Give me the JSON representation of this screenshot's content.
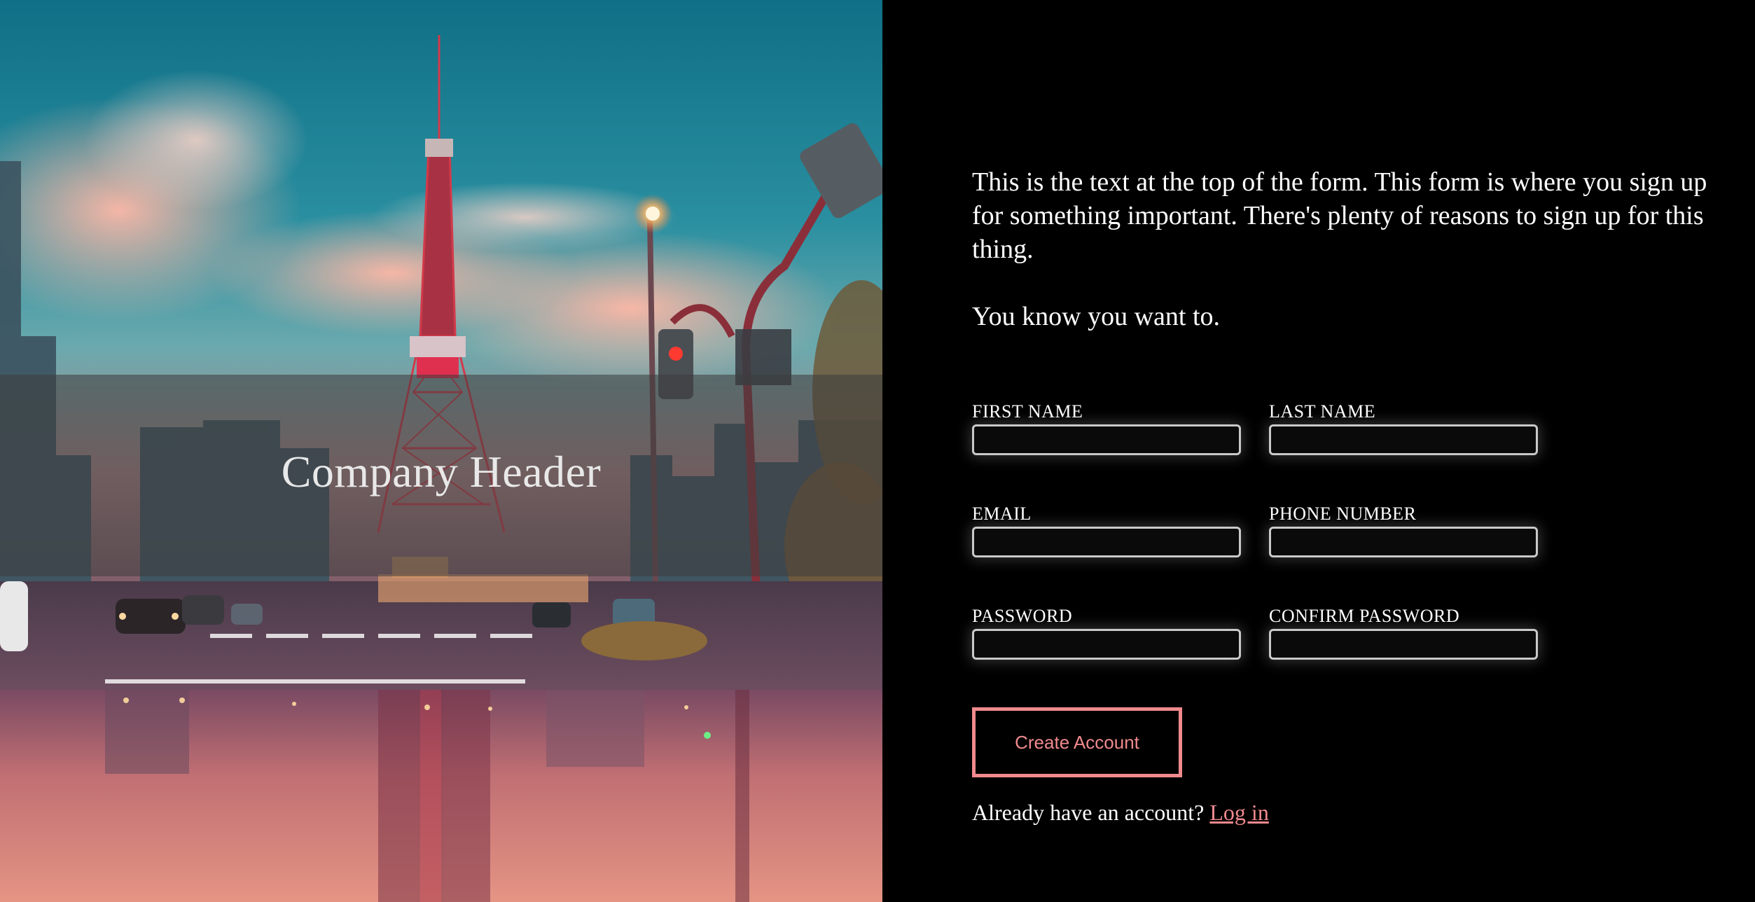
{
  "hero": {
    "title": "Company Header"
  },
  "form": {
    "intro_text": "This is the text at the top of the form. This form is where you sign up for something important. There's plenty of reasons to sign up for this thing.",
    "intro_text_2": "You know you want to.",
    "fields": {
      "first_name": {
        "label": "FIRST NAME",
        "value": ""
      },
      "last_name": {
        "label": "LAST NAME",
        "value": ""
      },
      "email": {
        "label": "EMAIL",
        "value": ""
      },
      "phone_number": {
        "label": "PHONE NUMBER",
        "value": ""
      },
      "password": {
        "label": "PASSWORD",
        "value": ""
      },
      "confirm_password": {
        "label": "CONFIRM PASSWORD",
        "value": ""
      }
    },
    "submit_label": "Create Account",
    "login_prompt": "Already have an account?",
    "login_link": "Log in"
  },
  "colors": {
    "accent": "#f08a8e",
    "background": "#000000",
    "text": "#ffffff",
    "input_border": "#c9c9c9"
  }
}
